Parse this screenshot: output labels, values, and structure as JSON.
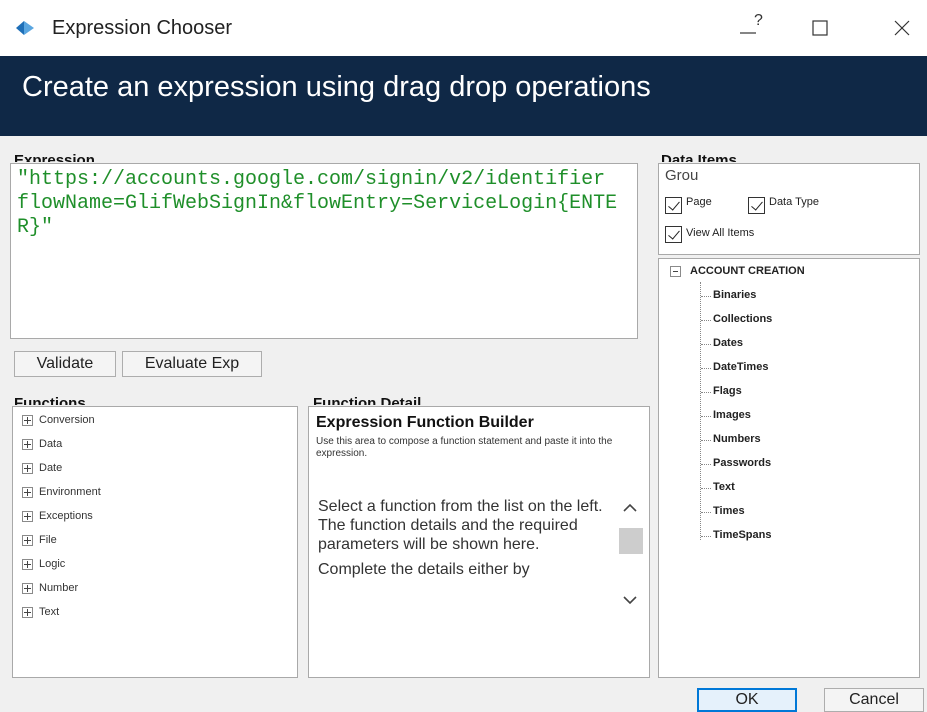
{
  "window": {
    "title": "Expression Chooser",
    "help_symbol": "?",
    "banner": "Create an expression using drag drop operations"
  },
  "expression": {
    "label": "Expression",
    "text": "\"https://accounts.google.com/signin/v2/identifier\nflowName=GlifWebSignIn&flowEntry=ServiceLogin{ENTER}\""
  },
  "buttons": {
    "validate": "Validate",
    "evaluate": "Evaluate Exp",
    "ok": "OK",
    "cancel": "Cancel"
  },
  "functions": {
    "label": "Functions",
    "items": [
      "Conversion",
      "Data",
      "Date",
      "Environment",
      "Exceptions",
      "File",
      "Logic",
      "Number",
      "Text"
    ]
  },
  "function_detail": {
    "label": "Function Detail",
    "title": "Expression Function Builder",
    "subtitle": "Use this area to compose a function statement and paste it into the expression.",
    "body": "Select a function from the list on the left. The function details and the required parameters will be shown here.",
    "body2": "Complete the details either by"
  },
  "data_items": {
    "label": "Data Items",
    "group_text": "Grou",
    "checkboxes": {
      "page": "Page",
      "data_type": "Data Type",
      "view_all": "View All Items"
    },
    "tree": {
      "root": "ACCOUNT CREATION",
      "children": [
        "Binaries",
        "Collections",
        "Dates",
        "DateTimes",
        "Flags",
        "Images",
        "Numbers",
        "Passwords",
        "Text",
        "Times",
        "TimeSpans"
      ]
    }
  },
  "colors": {
    "banner": "#0f2846",
    "expression_text": "#1f8f2a",
    "dialog_bg": "#f0f0f0"
  }
}
